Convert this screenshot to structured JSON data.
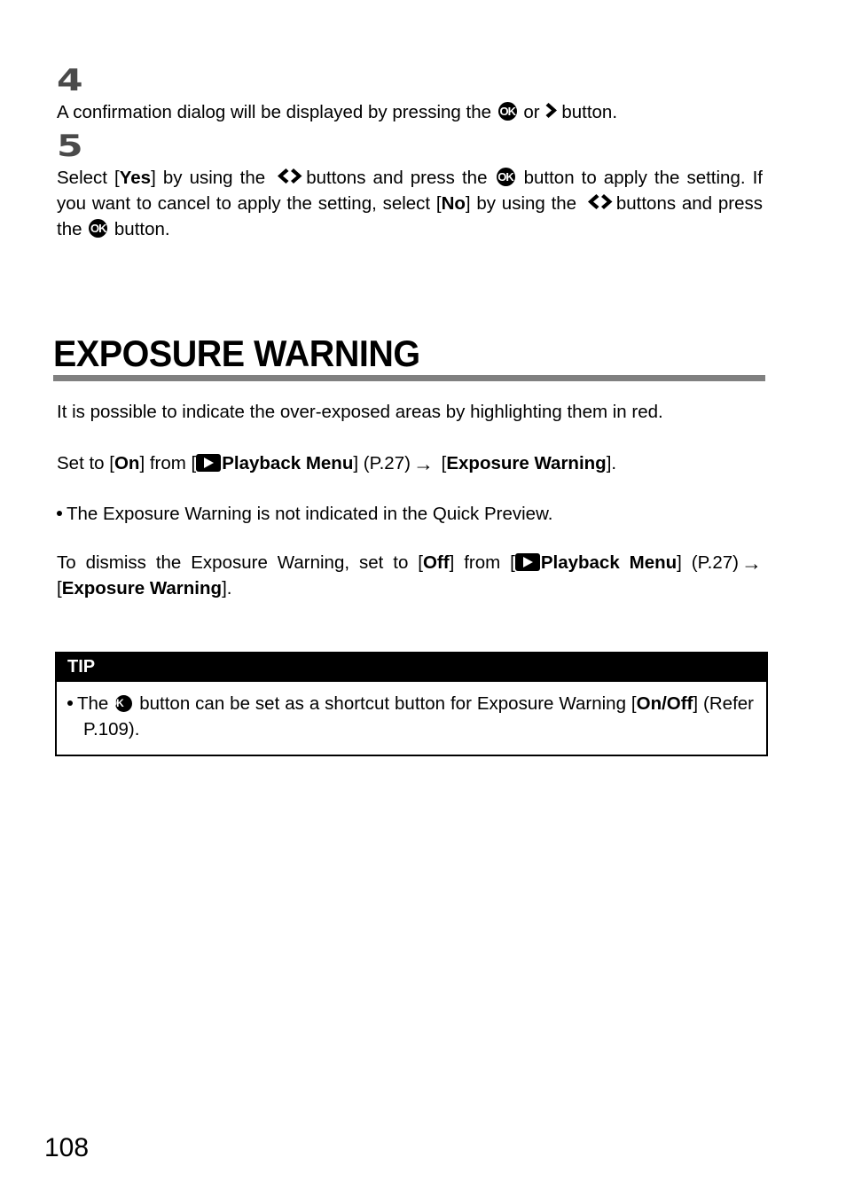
{
  "page": {
    "number": "108"
  },
  "steps": [
    {
      "number": "4",
      "icon_name": "step-4-number",
      "text_parts": {
        "p1": "A confirmation dialog will be displayed by pressing the ",
        "ok": "OK",
        "p2": " or ",
        "p3": "button."
      }
    },
    {
      "number": "5",
      "icon_name": "step-5-number",
      "text_parts": {
        "p1": "Select [",
        "yes": "Yes",
        "p2": "] by using the ",
        "p3": "buttons and press the ",
        "ok1": "OK",
        "p4": " button to apply the setting. If you want to cancel to apply the setting, select [",
        "no": "No",
        "p5": "] by using the ",
        "p6": "buttons and press the ",
        "ok2": "OK",
        "p7": " button."
      }
    }
  ],
  "section": {
    "title": "EXPOSURE WARNING",
    "intro": "It is possible to indicate the over-exposed areas by highlighting them in red.",
    "set_to": {
      "p1": "Set to [",
      "on": "On",
      "p2": "] from [",
      "menu": "Playback Menu",
      "p3": "] (P.27)",
      "arrow": "→",
      "p4": " [",
      "target": "Exposure Warning",
      "p5": "]."
    },
    "note": "The Exposure Warning is not indicated in the Quick Preview.",
    "dismiss": {
      "p1": "To dismiss the Exposure Warning, set to [",
      "off": "Off",
      "p2": "] from [",
      "menu": "Playback Menu",
      "p3": "] (P.27)",
      "arrow": "→",
      "p4": " [",
      "target": "Exposure Warning",
      "p5": "]."
    }
  },
  "tip": {
    "header": "TIP",
    "body": {
      "p1": "The ",
      "ok": "OK",
      "p2": " button can be set as a shortcut button for Exposure Warning [",
      "onoff": "On/Off",
      "p3": "] (Refer P.109)."
    }
  },
  "icons": {
    "ok_button": "ok-button-icon",
    "right_chevron": "chevron-right-icon",
    "left_right_chevron": "chevron-left-right-icon",
    "playback": "playback-play-icon",
    "arrow": "arrow-right-icon",
    "bullet": "bullet-dot-icon"
  },
  "colors": {
    "rule_gray": "#808080",
    "step_number_gray": "#4a4a4a",
    "black": "#000000",
    "white": "#ffffff"
  }
}
